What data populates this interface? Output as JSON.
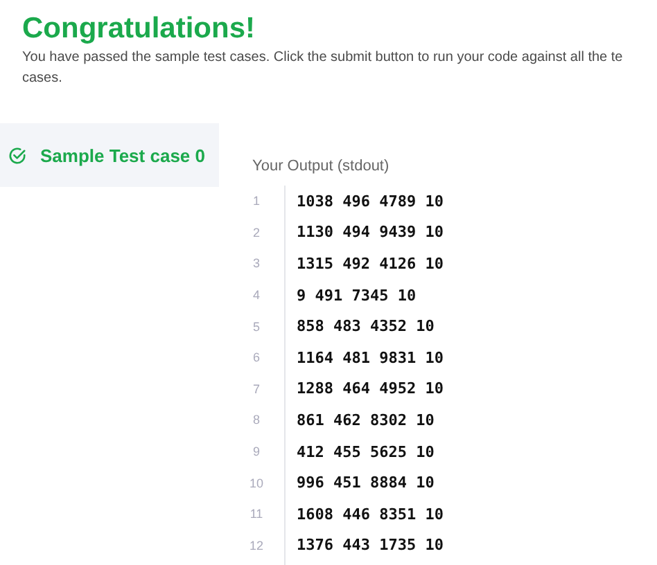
{
  "header": {
    "title": "Congratulations!",
    "message_lines": [
      "You have passed the sample test cases. Click the submit button to run your code against all the te",
      "cases."
    ]
  },
  "test_cases": [
    {
      "label": "Sample Test case 0",
      "selected": true,
      "passed": true
    }
  ],
  "output": {
    "label": "Your Output (stdout)",
    "lines": [
      {
        "number": "1",
        "text": "1038 496 4789 10"
      },
      {
        "number": "2",
        "text": "1130 494 9439 10"
      },
      {
        "number": "3",
        "text": "1315 492 4126 10"
      },
      {
        "number": "4",
        "text": "9 491 7345 10"
      },
      {
        "number": "5",
        "text": "858 483 4352 10"
      },
      {
        "number": "6",
        "text": "1164 481 9831 10"
      },
      {
        "number": "7",
        "text": "1288 464 4952 10"
      },
      {
        "number": "8",
        "text": "861 462 8302 10"
      },
      {
        "number": "9",
        "text": "412 455 5625 10"
      },
      {
        "number": "10",
        "text": "996 451 8884 10"
      },
      {
        "number": "11",
        "text": "1608 446 8351 10"
      },
      {
        "number": "12",
        "text": "1376 443 1735 10"
      }
    ]
  }
}
